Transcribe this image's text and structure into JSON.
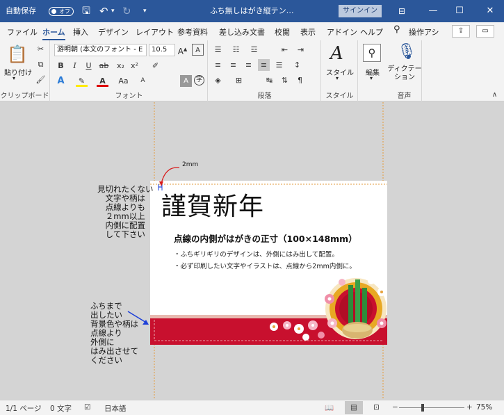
{
  "titlebar": {
    "autosave_label": "自動保存",
    "autosave_state": "オフ",
    "doc_title": "ふち無しはがき縦テン…",
    "signin_label": "サインイン",
    "min": "—",
    "max": "☐",
    "close": "✕"
  },
  "tabs": {
    "items": [
      "ファイル",
      "ホーム",
      "挿入",
      "デザイン",
      "レイアウト",
      "参考資料",
      "差し込み文書",
      "校閲",
      "表示",
      "アドイン",
      "ヘルプ"
    ],
    "search_label": "操作アシ",
    "share_icon": "share-icon",
    "comment_icon": "comment-icon"
  },
  "ribbon": {
    "clipboard": {
      "paste_label": "貼り付け",
      "group_label": "クリップボード"
    },
    "font": {
      "font_name": "游明朝 (本文のフォント - E",
      "font_size": "10.5",
      "group_label": "フォント"
    },
    "paragraph": {
      "group_label": "段落"
    },
    "styles": {
      "style_label": "スタイル",
      "group_label": "スタイル"
    },
    "editing": {
      "edit_label": "編集"
    },
    "voice": {
      "dictation_label": "ディクテー\nション",
      "group_label": "音声"
    }
  },
  "document": {
    "measure_label": "2mm",
    "greeting": "謹賀新年",
    "heading": "点線の内側がはがきの正寸（100×148mm）",
    "bullet1": "・ふちギリギリのデザインは、外側にはみ出して配置。",
    "bullet2": "・必ず印刷したい文字やイラストは、点線から2mm内側に。",
    "annotation_top": "見切れたくない\n文字や柄は\n点線よりも\n２mm以上\n内側に配置\nして下さい",
    "annotation_bottom": "ふちまで\n出したい\n背景色や柄は\n点線より\n外側に\nはみ出させて\nください",
    "colors": {
      "band": "#c8102e",
      "band_top": "#e8b9b0",
      "accent": "#2b579a"
    }
  },
  "status": {
    "page": "1/1 ページ",
    "words": "0 文字",
    "language": "日本語",
    "zoom": "75%",
    "zoom_level": 0.75
  }
}
